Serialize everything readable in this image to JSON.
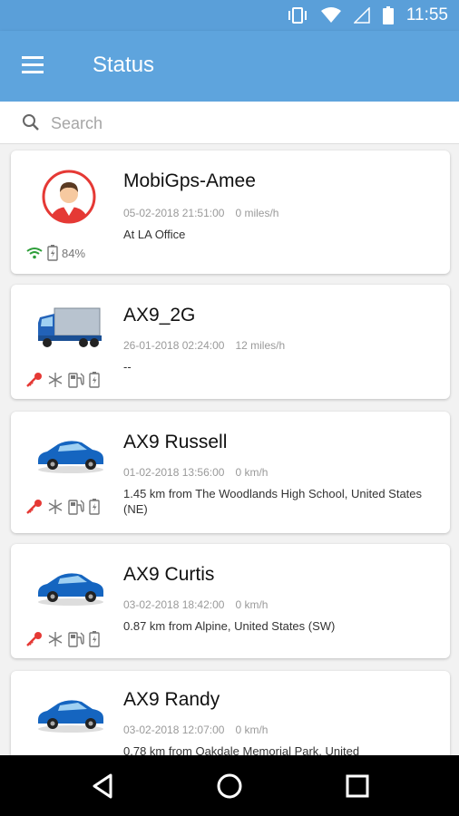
{
  "status_bar": {
    "time": "11:55"
  },
  "app_bar": {
    "title": "Status"
  },
  "search": {
    "placeholder": "Search"
  },
  "devices": [
    {
      "name": "MobiGps-Amee",
      "datetime": "05-02-2018 21:51:00",
      "speed": "0 miles/h",
      "address": "At LA Office",
      "battery": "84%",
      "icon": "person-avatar-icon"
    },
    {
      "name": "AX9_2G",
      "datetime": "26-01-2018 02:24:00",
      "speed": "12 miles/h",
      "address": "--",
      "icon": "truck-icon"
    },
    {
      "name": "AX9 Russell",
      "datetime": "01-02-2018 13:56:00",
      "speed": "0 km/h",
      "address": "1.45 km from The Woodlands High School, United States (NE)",
      "icon": "car-icon"
    },
    {
      "name": "AX9 Curtis",
      "datetime": "03-02-2018 18:42:00",
      "speed": "0 km/h",
      "address": "0.87 km from Alpine, United States (SW)",
      "icon": "car-icon"
    },
    {
      "name": "AX9 Randy",
      "datetime": "03-02-2018 12:07:00",
      "speed": "0 km/h",
      "address": "0.78 km from Oakdale Memorial Park, United",
      "icon": "car-icon"
    }
  ],
  "colors": {
    "app_bar": "#5ea4dd",
    "status_bar": "#5a9fd9",
    "ignition_red": "#e53935",
    "wifi_green": "#2e9e3a"
  }
}
